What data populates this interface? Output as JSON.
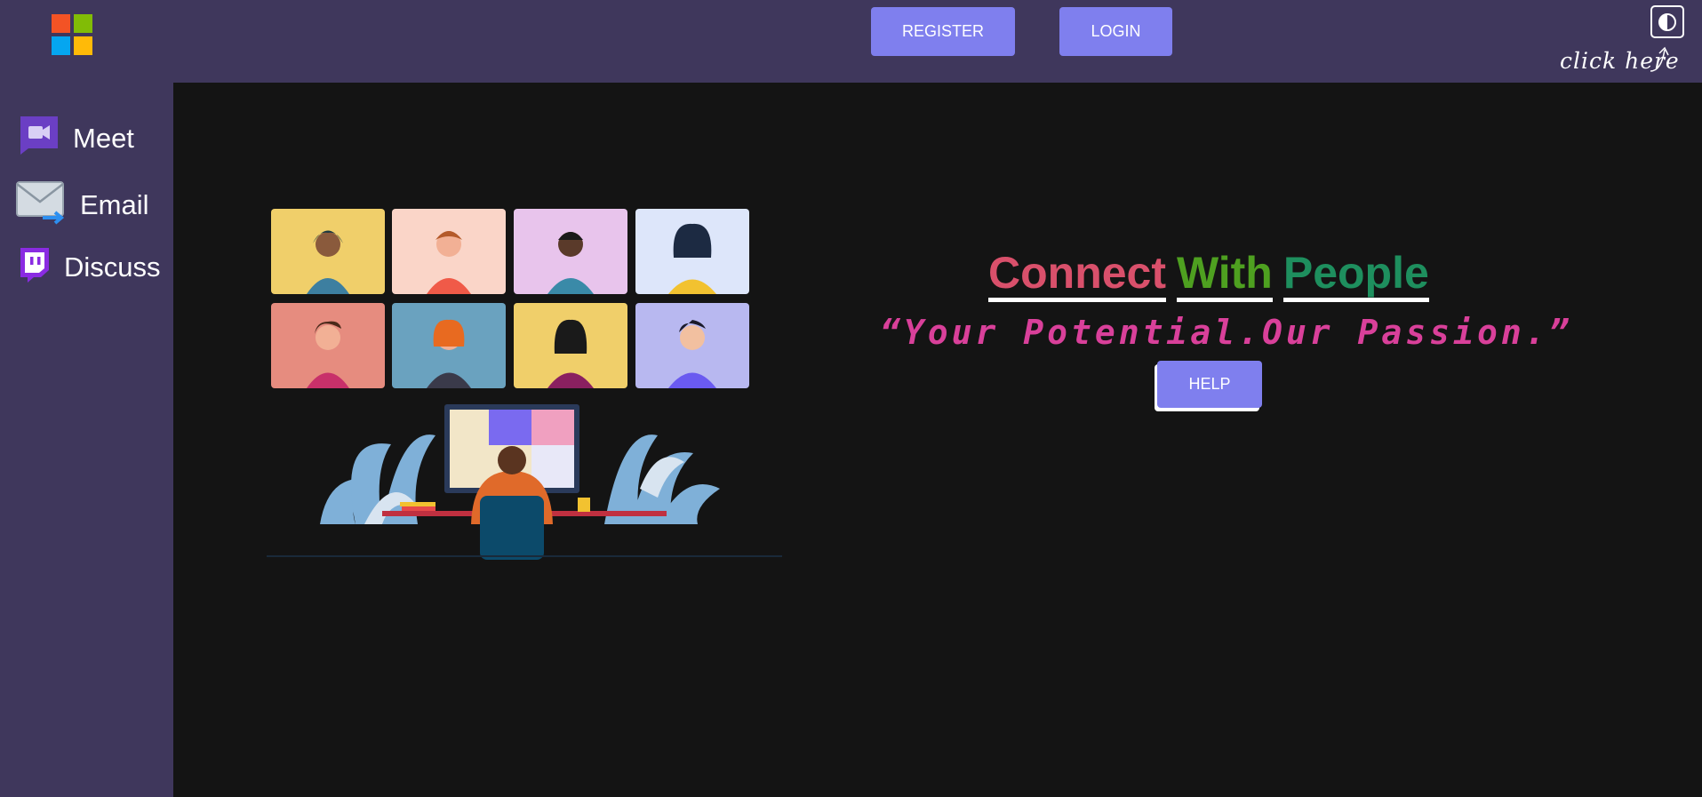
{
  "header": {
    "register_label": "REGISTER",
    "login_label": "LOGIN",
    "theme_hint": "click here"
  },
  "sidebar": {
    "items": [
      {
        "label": "Meet",
        "icon": "video-camera-icon"
      },
      {
        "label": "Email",
        "icon": "envelope-icon"
      },
      {
        "label": "Discuss",
        "icon": "chat-icon"
      }
    ]
  },
  "hero": {
    "headline": {
      "word1": "Connect",
      "word2": "With",
      "word3": "People"
    },
    "tagline": "“Your Potential.Our Passion.”",
    "help_label": "HELP"
  },
  "colors": {
    "header_bg": "#3f375c",
    "main_bg": "#141414",
    "button": "#7f7fee",
    "connect": "#d9506b",
    "with": "#4ea020",
    "people": "#1e8f5e",
    "tagline": "#d9409a"
  }
}
